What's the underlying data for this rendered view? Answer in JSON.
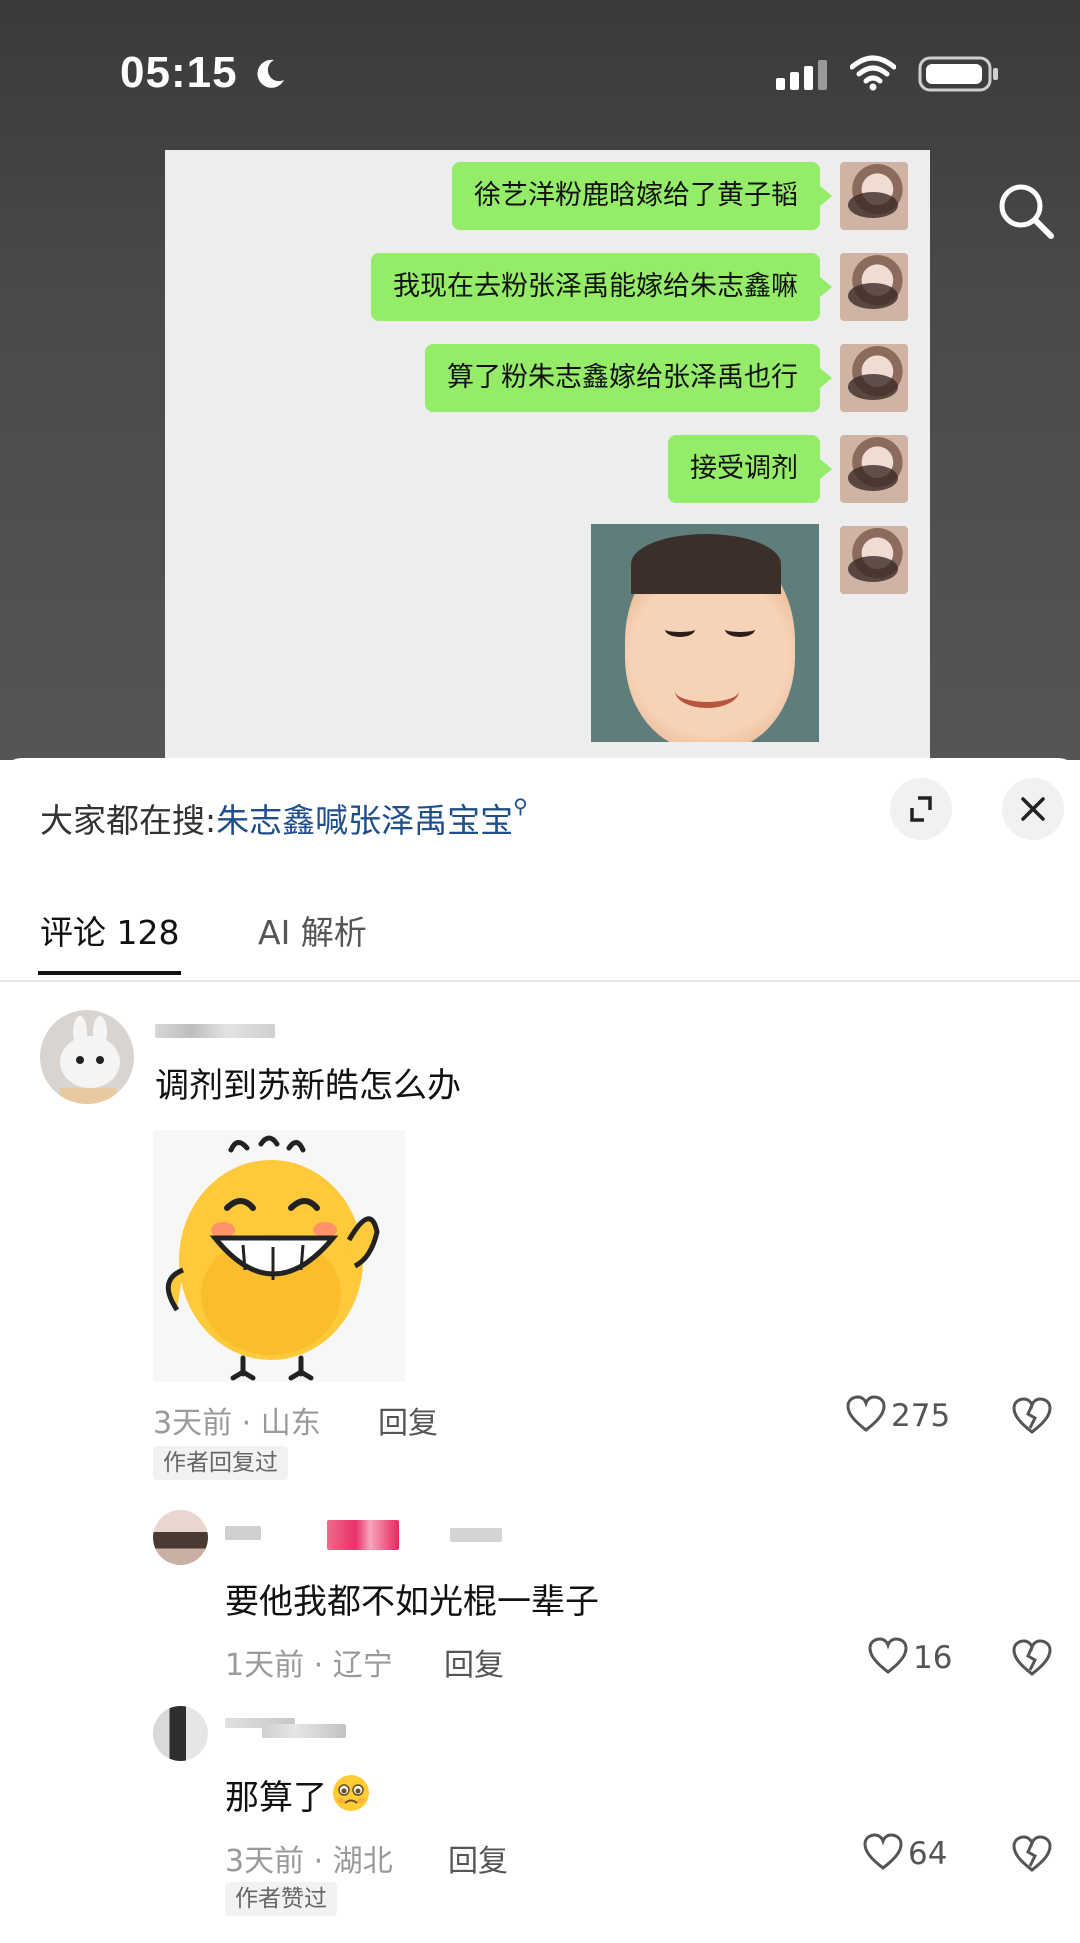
{
  "status_bar": {
    "time": "05:15",
    "icons": [
      "moon-icon",
      "signal-icon",
      "wifi-icon",
      "battery-icon"
    ]
  },
  "video": {
    "search_icon": "search-icon",
    "chat_messages": [
      "徐艺洋粉鹿晗嫁给了黄子韬",
      "我现在去粉张泽禹能嫁给朱志鑫嘛",
      "算了粉朱志鑫嫁给张泽禹也行",
      "接受调剂"
    ]
  },
  "sheet": {
    "suggest_prefix": "大家都在搜:",
    "suggest_query": "朱志鑫喊张泽禹宝宝",
    "tabs": [
      "评论 128",
      "AI 解析"
    ]
  },
  "comments": [
    {
      "text": "调剂到苏新皓怎么办",
      "meta": "3天前 · 山东",
      "reply_label": "回复",
      "likes": "275",
      "tag": "作者回复过",
      "has_sticker": true
    },
    {
      "text": "要他我都不如光棍一辈子",
      "meta": "1天前 · 辽宁",
      "reply_label": "回复",
      "likes": "16"
    },
    {
      "text": "那算了",
      "meta": "3天前 · 湖北",
      "reply_label": "回复",
      "likes": "64",
      "tag": "作者赞过"
    }
  ],
  "colors": {
    "chat_bubble": "#95ec69",
    "link": "#1f4e8c"
  }
}
